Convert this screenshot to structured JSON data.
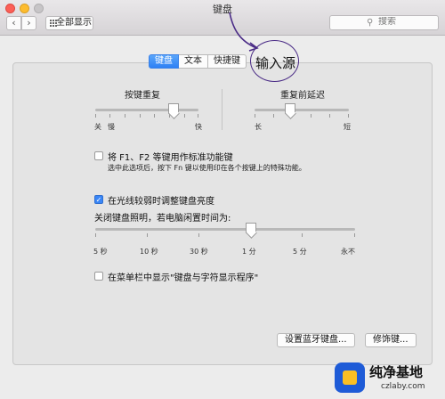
{
  "window": {
    "title": "键盘"
  },
  "toolbar": {
    "back_icon": "chevron-left-icon",
    "forward_icon": "chevron-right-icon",
    "show_all_label": "全部显示",
    "search_placeholder": "搜索"
  },
  "tabs": [
    {
      "label": "键盘",
      "active": true
    },
    {
      "label": "文本",
      "active": false
    },
    {
      "label": "快捷键",
      "active": false
    },
    {
      "label": "输入源",
      "active": false
    }
  ],
  "key_repeat": {
    "label": "按键重复",
    "left_labels": [
      "关",
      "慢"
    ],
    "right_label": "快",
    "level_fraction": 0.76
  },
  "delay_until_repeat": {
    "label": "重复前延迟",
    "left_label": "长",
    "right_label": "短",
    "level_fraction": 0.38
  },
  "fn_keys": {
    "checked": false,
    "label": "将 F1、F2 等键用作标准功能键",
    "hint": "选中此选项后，按下 Fn 键以使用印在各个按键上的特殊功能。"
  },
  "brightness": {
    "checked": true,
    "label": "在光线较弱时调整键盘亮度"
  },
  "backlight_off": {
    "label": "关闭键盘照明，若电脑闲置时间为:",
    "tick_labels": [
      "5 秒",
      "10 秒",
      "30 秒",
      "1 分",
      "5 分",
      "永不"
    ],
    "level_fraction": 0.6
  },
  "menu_bar": {
    "checked": false,
    "label": "在菜单栏中显示\"键盘与字符显示程序\""
  },
  "buttons": {
    "bluetooth": "设置蓝牙键盘...",
    "modifier": "修饰键..."
  },
  "watermark": {
    "title": "纯净基地",
    "url": "czlaby.com",
    "accent": "#1e5bd7"
  },
  "colors": {
    "accent": "#2d80f5",
    "annotation": "#4a2b86"
  }
}
